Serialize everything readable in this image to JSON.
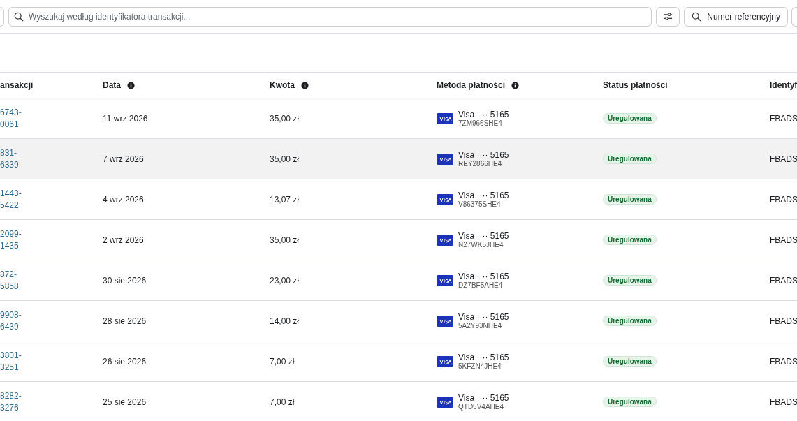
{
  "toolbar": {
    "search": {
      "placeholder": "Wyszukaj według identyfikatora transakcji..."
    },
    "reference_button": "Numer referencyjny"
  },
  "table": {
    "columns": [
      {
        "label": "ansakcji",
        "info": false
      },
      {
        "label": "Data",
        "info": true
      },
      {
        "label": "Kwota",
        "info": true
      },
      {
        "label": "Metoda płatności",
        "info": true
      },
      {
        "label": "Status płatności",
        "info": false
      },
      {
        "label": "Identyf"
      }
    ],
    "rows": [
      {
        "id": [
          "6743-",
          "0061"
        ],
        "date": "11 wrz 2026",
        "amount": "35,00 zł",
        "card": "Visa ···· 5165",
        "card_ref": "7ZM966SHE4",
        "status": "Uregulowana",
        "ref": "FBADS",
        "highlighted": false
      },
      {
        "id": [
          "831-",
          "6339"
        ],
        "date": "7 wrz 2026",
        "amount": "35,00 zł",
        "card": "Visa ···· 5165",
        "card_ref": "REY2866HE4",
        "status": "Uregulowana",
        "ref": "FBADS",
        "highlighted": true
      },
      {
        "id": [
          "1443-",
          "5422"
        ],
        "date": "4 wrz 2026",
        "amount": "13,07 zł",
        "card": "Visa ···· 5165",
        "card_ref": "V86375SHE4",
        "status": "Uregulowana",
        "ref": "FBADS",
        "highlighted": false
      },
      {
        "id": [
          "2099-",
          "1435"
        ],
        "date": "2 wrz 2026",
        "amount": "35,00 zł",
        "card": "Visa ···· 5165",
        "card_ref": "N27WK5JHE4",
        "status": "Uregulowana",
        "ref": "FBADS",
        "highlighted": false
      },
      {
        "id": [
          "872-",
          "5858"
        ],
        "date": "30 sie 2026",
        "amount": "23,00 zł",
        "card": "Visa ···· 5165",
        "card_ref": "DZ7BF5AHE4",
        "status": "Uregulowana",
        "ref": "FBADS",
        "highlighted": false
      },
      {
        "id": [
          "9908-",
          "6439"
        ],
        "date": "28 sie 2026",
        "amount": "14,00 zł",
        "card": "Visa ···· 5165",
        "card_ref": "5A2Y93NHE4",
        "status": "Uregulowana",
        "ref": "FBADS",
        "highlighted": false
      },
      {
        "id": [
          "3801-",
          "3251"
        ],
        "date": "26 sie 2026",
        "amount": "7,00 zł",
        "card": "Visa ···· 5165",
        "card_ref": "5KFZN4JHE4",
        "status": "Uregulowana",
        "ref": "FBADS",
        "highlighted": false
      },
      {
        "id": [
          "8282-",
          "3276"
        ],
        "date": "25 sie 2026",
        "amount": "7,00 zł",
        "card": "Visa ···· 5165",
        "card_ref": "QTD5V4AHE4",
        "status": "Uregulowana",
        "ref": "FBADS",
        "highlighted": false
      }
    ]
  }
}
